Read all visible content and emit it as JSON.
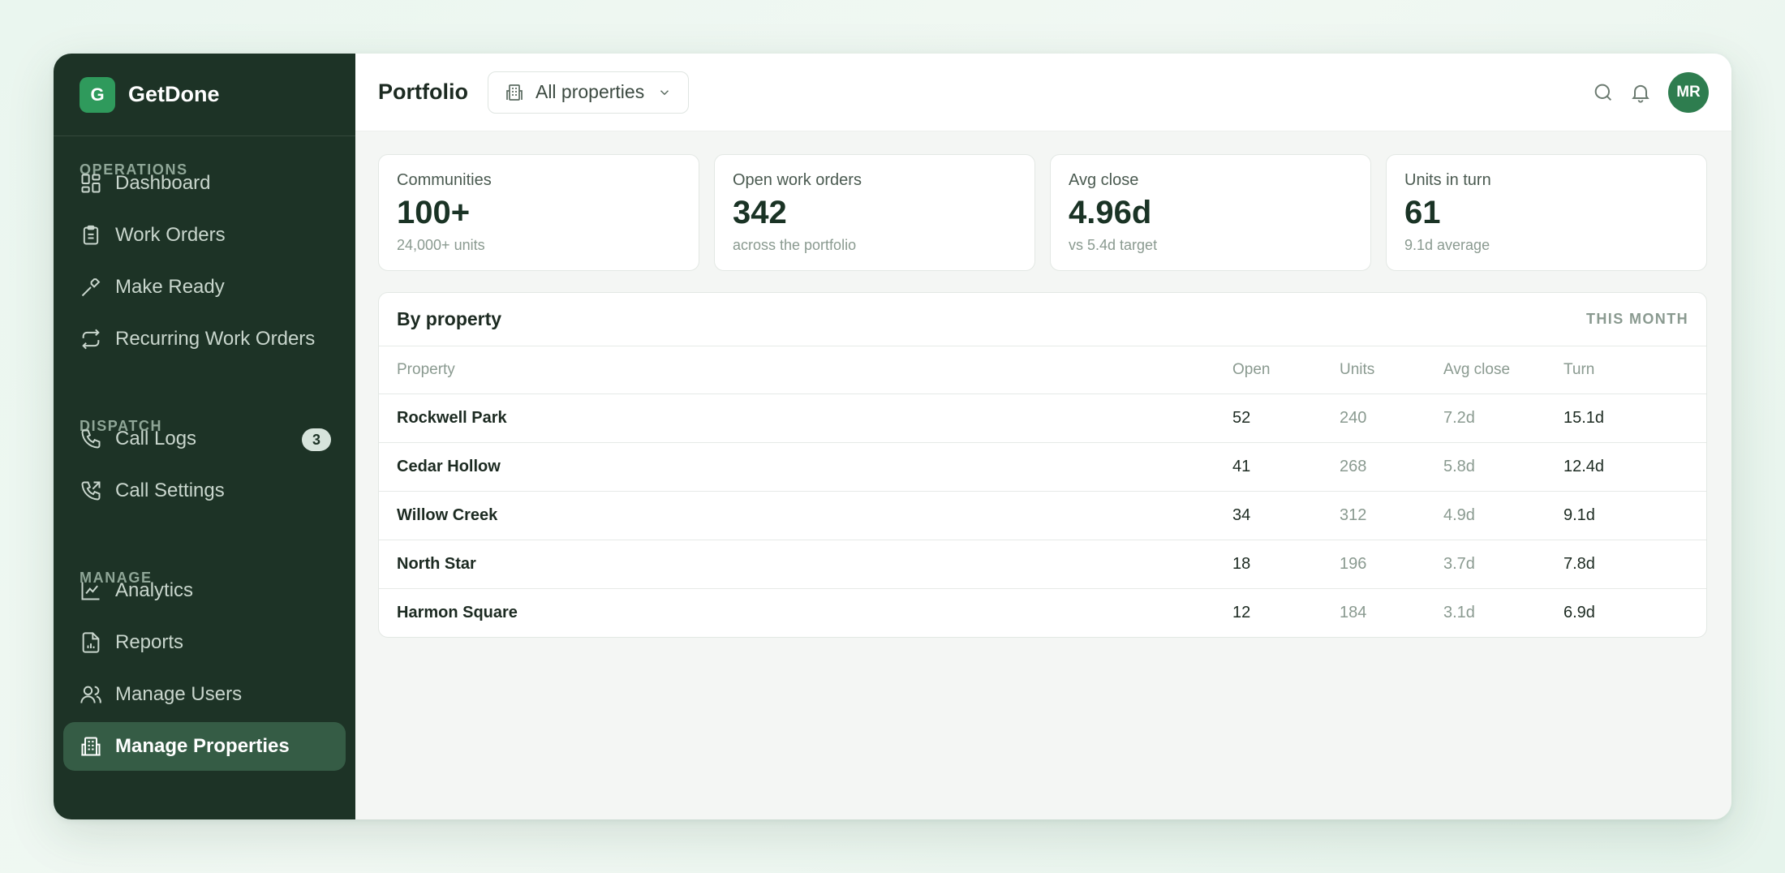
{
  "brand": {
    "logo_letter": "G",
    "name": "GetDone",
    "accent": "#2f9a5c"
  },
  "sidebar": {
    "background": "#1d3326",
    "sections": [
      {
        "label": "OPERATIONS"
      },
      {
        "label": "DISPATCH"
      },
      {
        "label": "MANAGE"
      }
    ],
    "items": [
      {
        "label": "Dashboard",
        "icon": "dashboard-grid-icon"
      },
      {
        "label": "Work Orders",
        "icon": "clipboard-icon"
      },
      {
        "label": "Make Ready",
        "icon": "hammer-icon"
      },
      {
        "label": "Recurring Work Orders",
        "icon": "repeat-icon"
      },
      {
        "label": "Call Logs",
        "icon": "phone-icon",
        "badge": "3"
      },
      {
        "label": "Call Settings",
        "icon": "phone-settings-icon"
      },
      {
        "label": "Analytics",
        "icon": "line-chart-icon"
      },
      {
        "label": "Reports",
        "icon": "report-file-icon"
      },
      {
        "label": "Manage Users",
        "icon": "users-icon"
      },
      {
        "label": "Manage Properties",
        "icon": "building-icon",
        "active": true
      }
    ]
  },
  "header": {
    "title": "Portfolio",
    "property_filter": "All properties",
    "avatar_initials": "MR",
    "avatar_color": "#2e7d4f"
  },
  "stats": [
    {
      "label": "Communities",
      "value": "100+",
      "sub": "24,000+ units"
    },
    {
      "label": "Open work orders",
      "value": "342",
      "sub": "across the portfolio"
    },
    {
      "label": "Avg close",
      "value": "4.96d",
      "sub": "vs 5.4d target"
    },
    {
      "label": "Units in turn",
      "value": "61",
      "sub": "9.1d average"
    }
  ],
  "by_property": {
    "title": "By property",
    "range": "THIS MONTH",
    "columns": [
      "Property",
      "Open",
      "Units",
      "Avg close",
      "Turn"
    ],
    "rows": [
      [
        "Rockwell Park",
        "52",
        "240",
        "7.2d",
        "15.1d"
      ],
      [
        "Cedar Hollow",
        "41",
        "268",
        "5.8d",
        "12.4d"
      ],
      [
        "Willow Creek",
        "34",
        "312",
        "4.9d",
        "9.1d"
      ],
      [
        "North Star",
        "18",
        "196",
        "3.7d",
        "7.8d"
      ],
      [
        "Harmon Square",
        "12",
        "184",
        "3.1d",
        "6.9d"
      ]
    ]
  }
}
